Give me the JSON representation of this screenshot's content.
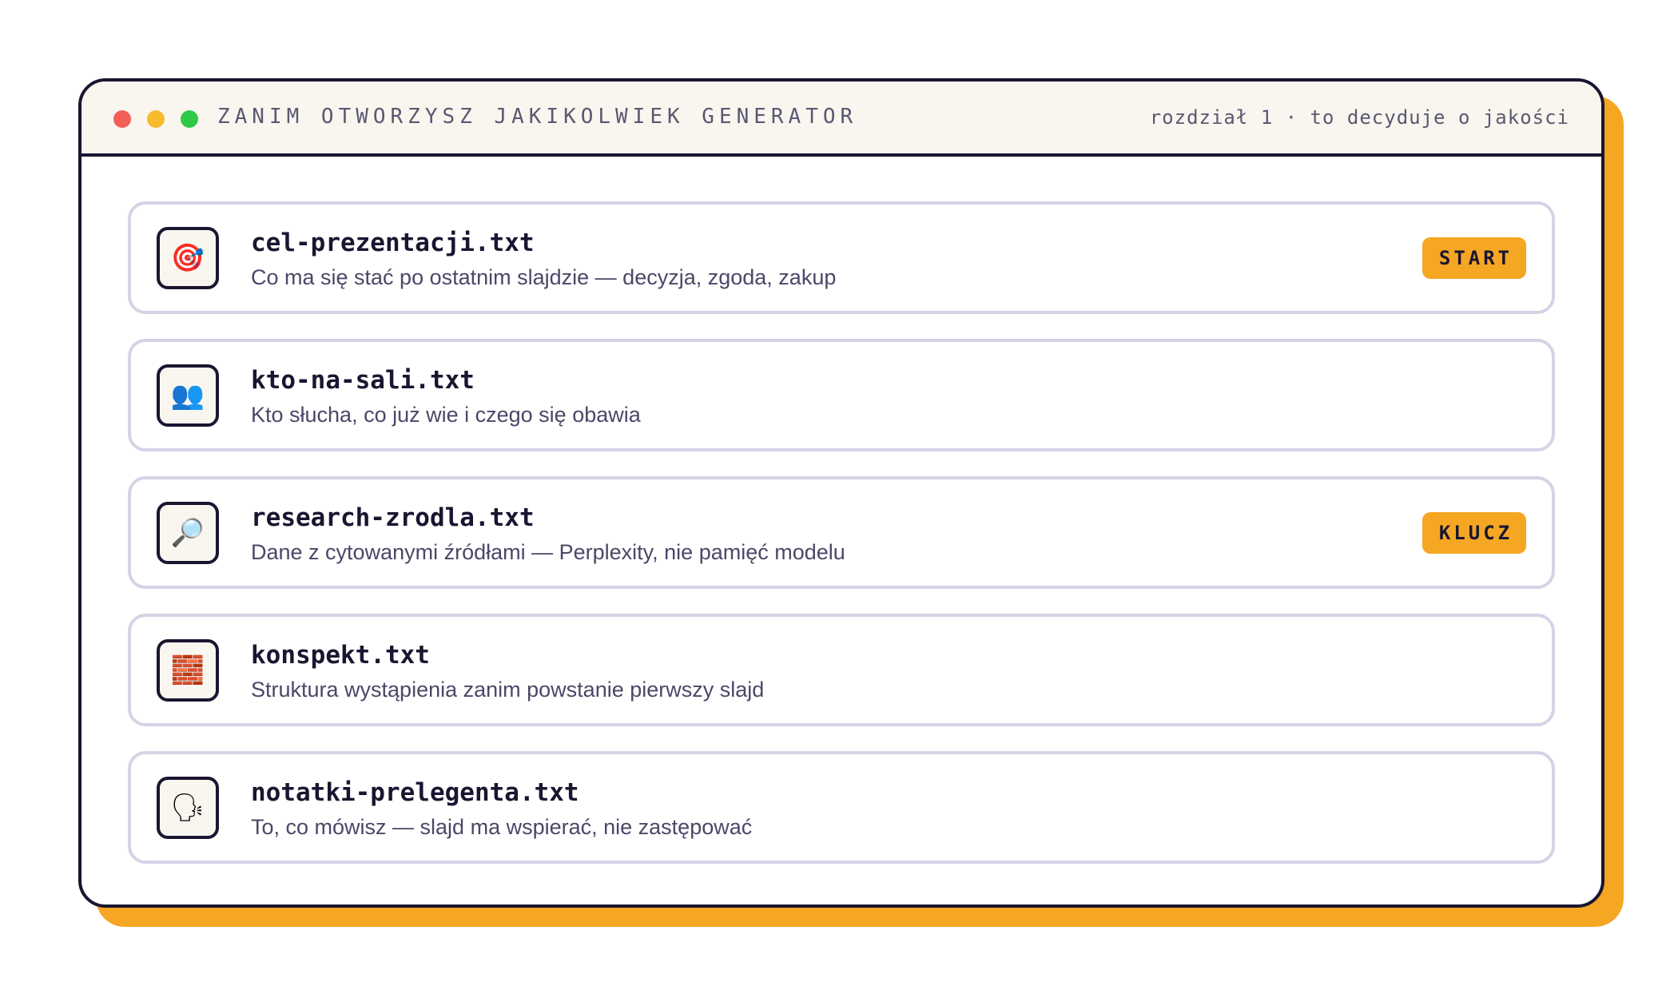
{
  "window": {
    "title": "ZANIM OTWORZYSZ JAKIKOLWIEK GENERATOR",
    "subtitle": "rozdział 1 · to decyduje o jakości"
  },
  "colors": {
    "accent": "#f5a623",
    "dot_red": "#f25f57",
    "dot_yellow": "#f8bb2d",
    "dot_green": "#2ec946",
    "ink": "#1a1530",
    "card_border": "#d6d3e6"
  },
  "files": [
    {
      "icon_name": "target-icon",
      "icon": "🎯",
      "name": "cel-prezentacji.txt",
      "description": "Co ma się stać po ostatnim slajdzie — decyzja, zgoda, zakup",
      "badge": "START"
    },
    {
      "icon_name": "people-icon",
      "icon": "👥",
      "name": "kto-na-sali.txt",
      "description": "Kto słucha, co już wie i czego się obawia",
      "badge": ""
    },
    {
      "icon_name": "magnifier-icon",
      "icon": "🔎",
      "name": "research-zrodla.txt",
      "description": "Dane z cytowanymi źródłami — Perplexity, nie pamięć modelu",
      "badge": "KLUCZ"
    },
    {
      "icon_name": "bricks-icon",
      "icon": "🧱",
      "name": "konspekt.txt",
      "description": "Struktura wystąpienia zanim powstanie pierwszy slajd",
      "badge": ""
    },
    {
      "icon_name": "speaking-head-icon",
      "icon": "🗣",
      "name": "notatki-prelegenta.txt",
      "description": "To, co mówisz — slajd ma wspierać, nie zastępować",
      "badge": ""
    }
  ]
}
